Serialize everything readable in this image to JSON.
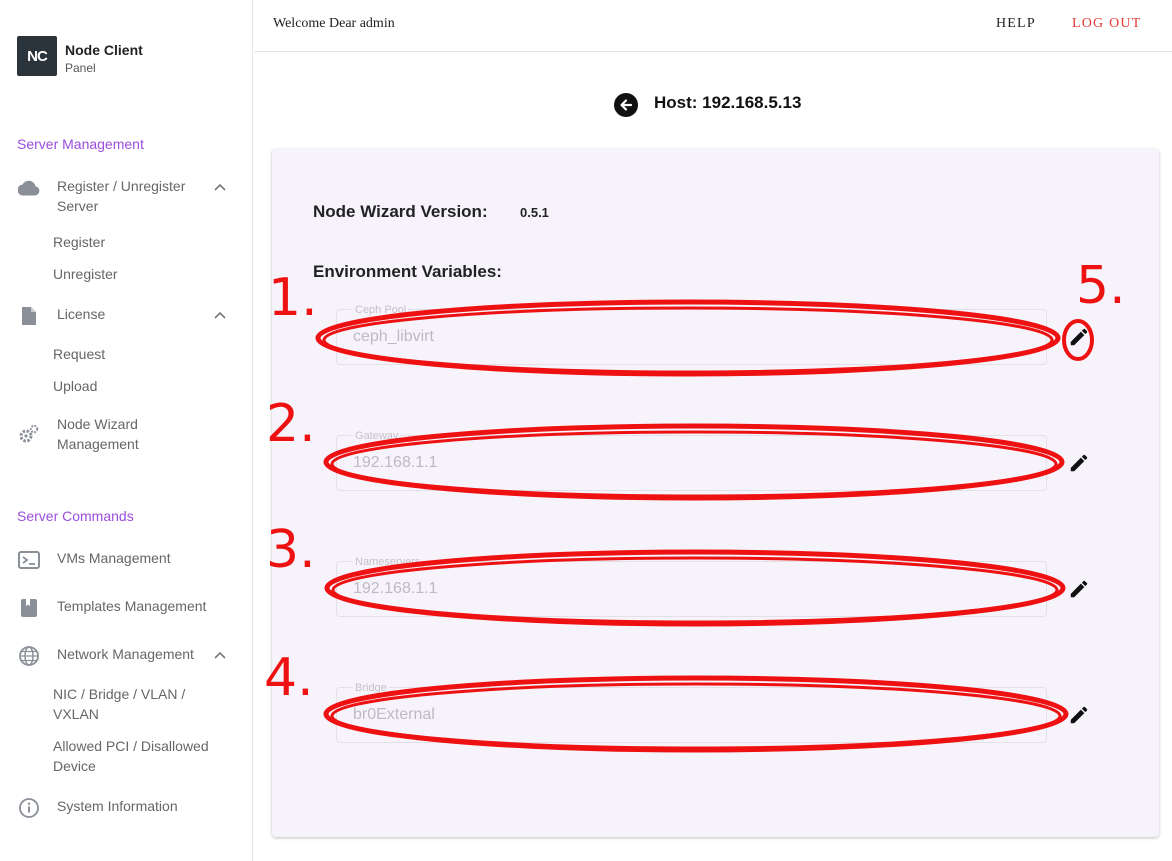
{
  "brand": {
    "logo": "NC",
    "title": "Node Client",
    "subtitle": "Panel"
  },
  "sidebar": {
    "sections": [
      {
        "title": "Server Management",
        "items": [
          {
            "label": "Register / Unregister Server",
            "icon": "cloud-icon",
            "expanded": true,
            "children": [
              "Register",
              "Unregister"
            ]
          },
          {
            "label": "License",
            "icon": "document-icon",
            "expanded": true,
            "children": [
              "Request",
              "Upload"
            ]
          },
          {
            "label": "Node Wizard Management",
            "icon": "gears-icon"
          }
        ]
      },
      {
        "title": "Server Commands",
        "items": [
          {
            "label": "VMs Management",
            "icon": "terminal-icon"
          },
          {
            "label": "Templates Management",
            "icon": "bookmark-icon"
          },
          {
            "label": "Network Management",
            "icon": "globe-icon",
            "expanded": true,
            "children": [
              "NIC / Bridge / VLAN / VXLAN",
              "Allowed PCI / Disallowed Device"
            ]
          },
          {
            "label": "System Information",
            "icon": "info-icon"
          }
        ]
      }
    ]
  },
  "topbar": {
    "welcome": "Welcome Dear admin",
    "help": "HELP",
    "logout": "LOG OUT"
  },
  "page": {
    "title": "Host: 192.168.5.13",
    "wizard_version_label": "Node Wizard Version:",
    "wizard_version": "0.5.1",
    "env_label": "Environment Variables:",
    "fields": [
      {
        "label": "Ceph Pool",
        "value": "ceph_libvirt"
      },
      {
        "label": "Gateway",
        "value": "192.168.1.1"
      },
      {
        "label": "Nameservers",
        "value": "192.168.1.1"
      },
      {
        "label": "Bridge",
        "value": "br0External"
      }
    ]
  },
  "annotations": {
    "color": "#ee1111",
    "numbers": [
      "1.",
      "2.",
      "3.",
      "4.",
      "5."
    ]
  },
  "colors": {
    "accent": "#9b4dde",
    "logout": "#e53935",
    "card_bg": "#f7f3fb",
    "annotation": "#ee1111"
  }
}
